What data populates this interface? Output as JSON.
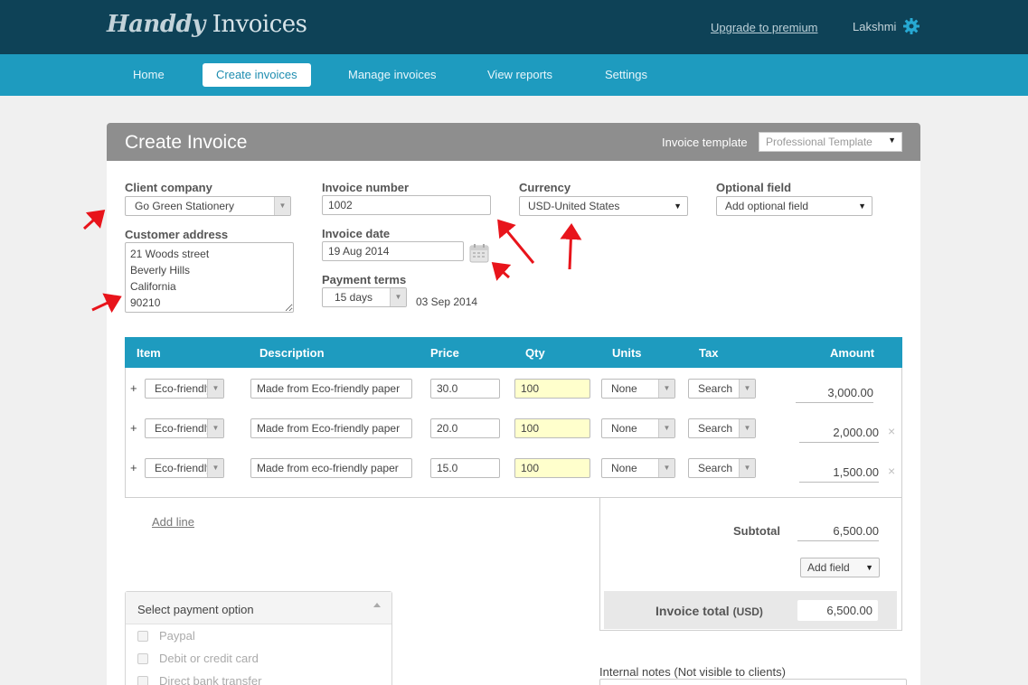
{
  "app": {
    "logo_brand": "Handdy",
    "logo_rest": "Invoices",
    "upgrade_link": "Upgrade to premium",
    "username": "Lakshmi",
    "settings_icon": "gear-icon"
  },
  "nav": {
    "items": [
      {
        "label": "Home",
        "active": false
      },
      {
        "label": "Create invoices",
        "active": true
      },
      {
        "label": "Manage invoices",
        "active": false
      },
      {
        "label": "View reports",
        "active": false
      },
      {
        "label": "Settings",
        "active": false
      }
    ]
  },
  "panel": {
    "title": "Create Invoice",
    "template_label": "Invoice template",
    "template_value": "Professional Template"
  },
  "form": {
    "client_company_label": "Client company",
    "client_company_value": "Go Green Stationery",
    "customer_address_label": "Customer address",
    "customer_address_value": "21 Woods street\nBeverly Hills\nCalifornia\n90210",
    "invoice_number_label": "Invoice number",
    "invoice_number_value": "1002",
    "invoice_date_label": "Invoice date",
    "invoice_date_value": "19 Aug 2014",
    "payment_terms_label": "Payment terms",
    "payment_terms_value": "15 days",
    "due_date": "03 Sep 2014",
    "currency_label": "Currency",
    "currency_value": "USD-United States",
    "optional_field_label": "Optional field",
    "optional_field_value": "Add optional field"
  },
  "items_table": {
    "headers": [
      "Item",
      "Description",
      "Price",
      "Qty",
      "Units",
      "Tax",
      "Amount"
    ],
    "rows": [
      {
        "add": "+",
        "item": "Eco-friendly",
        "description": "Made from Eco-friendly paper",
        "price": "30.0",
        "qty": "100",
        "units": "None",
        "tax": "Search",
        "amount": "3,000.00",
        "removable": false
      },
      {
        "add": "+",
        "item": "Eco-friendly",
        "description": "Made from Eco-friendly paper",
        "price": "20.0",
        "qty": "100",
        "units": "None",
        "tax": "Search",
        "amount": "2,000.00",
        "removable": true
      },
      {
        "add": "+",
        "item": "Eco-friendly",
        "description": "Made from eco-friendly paper",
        "price": "15.0",
        "qty": "100",
        "units": "None",
        "tax": "Search",
        "amount": "1,500.00",
        "removable": true
      }
    ],
    "remove_glyph": "×",
    "add_line": "Add line"
  },
  "totals": {
    "subtotal_label": "Subtotal",
    "subtotal_value": "6,500.00",
    "add_field": "Add field",
    "invoice_total_label": "Invoice total",
    "invoice_total_currency": "(USD)",
    "invoice_total_value": "6,500.00"
  },
  "payment": {
    "title": "Select payment option",
    "options": [
      "Paypal",
      "Debit or credit card",
      "Direct bank transfer"
    ]
  },
  "notes": {
    "label": "Internal notes (Not visible to clients)"
  },
  "colors": {
    "header_dark": "#0e4257",
    "nav_blue": "#1e9bbf",
    "panel_header_gray": "#8e8e8e",
    "qty_highlight": "#ffffcc",
    "annotation_red": "#e8141b"
  }
}
